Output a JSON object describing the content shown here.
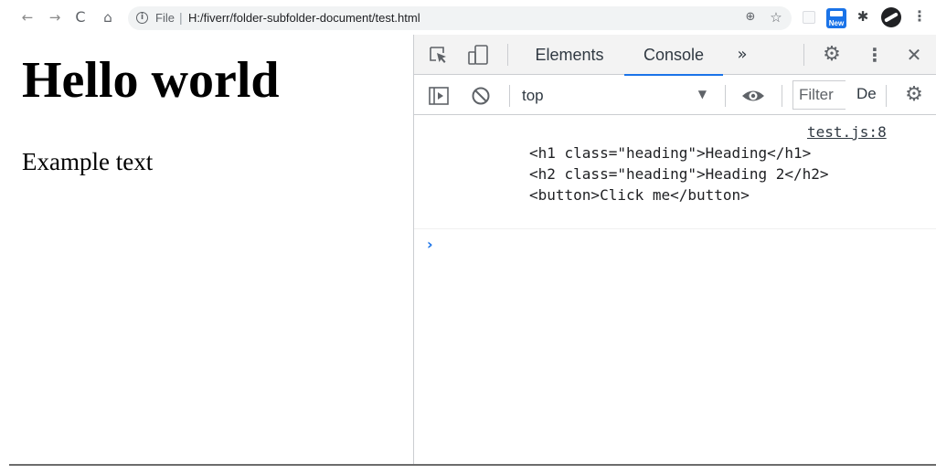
{
  "browser": {
    "nav": {
      "back": "←",
      "forward": "→",
      "reload": "C",
      "home": "⌂"
    },
    "address": {
      "info_glyph": "i",
      "scheme_label": "File",
      "separator": "|",
      "url": "H:/fiverr/folder-subfolder-document/test.html"
    },
    "icons": {
      "zoom": "⊕",
      "star": "☆",
      "puzzle": "✱",
      "menu": "⋮"
    },
    "extension_badge": "New"
  },
  "page": {
    "heading": "Hello world",
    "paragraph": "Example text"
  },
  "devtools": {
    "tabs": [
      {
        "label": "Elements",
        "active": false
      },
      {
        "label": "Console",
        "active": true
      }
    ],
    "more_tabs": "»",
    "icons": {
      "settings": "⚙",
      "menu": "⋮",
      "close": "✕"
    },
    "filterbar": {
      "context": "top",
      "context_arrow": "▼",
      "filter_placeholder": "Filter",
      "levels": "Default levels"
    },
    "console": {
      "source": "test.js:8",
      "lines": [
        "<h1 class=\"heading\">Heading</h1>",
        "<h2 class=\"heading\">Heading 2</h2>",
        "<button>Click me</button>"
      ],
      "prompt": "›"
    },
    "colors": {
      "accent": "#1a73e8",
      "toolbar_bg": "#f3f3f3",
      "border": "#cbcdd1"
    }
  }
}
